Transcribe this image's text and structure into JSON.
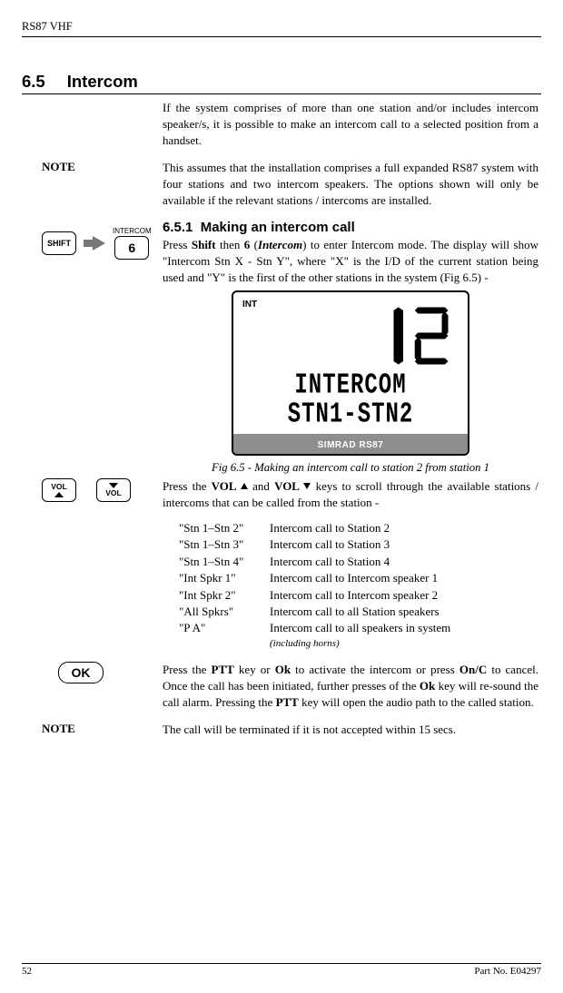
{
  "header": {
    "title": "RS87 VHF"
  },
  "section": {
    "number": "6.5",
    "title": "Intercom",
    "intro": "If the system comprises of more than one station and/or includes intercom speaker/s, it is possible to make an intercom call to a selected position from a handset."
  },
  "note1": {
    "label": "NOTE",
    "text": "This assumes that the installation comprises a full expanded RS87 system with four stations and two intercom speakers. The options shown will only be available if the relevant stations / intercoms are installed."
  },
  "icons": {
    "shift": "SHIFT",
    "intercom_label": "INTERCOM",
    "intercom_key": "6",
    "vol": "VOL",
    "ok": "OK"
  },
  "subsection": {
    "number": "6.5.1",
    "title": "Making an intercom call",
    "p1_a": "Press ",
    "p1_shift": "Shift",
    "p1_b": " then ",
    "p1_six": "6",
    "p1_c": " (",
    "p1_intercom": "Intercom",
    "p1_d": ") to enter Intercom mode.  The display will show \"Intercom Stn X - Stn Y\", where \"X\" is the I/D of the current station being used and \"Y\" is the first of the other stations in the system (Fig 6.5) -"
  },
  "figure": {
    "int": "INT",
    "line1": "INTERCOM",
    "line2": "STN1-STN2",
    "brand": "SIMRAD RS87",
    "caption": "Fig 6.5 - Making an intercom call to station 2 from station 1"
  },
  "p2_a": "Press the ",
  "p2_vol1": "VOL",
  "p2_b": " and ",
  "p2_vol2": "VOL",
  "p2_c": " keys to scroll through the available stations / intercoms that can be called from the station -",
  "options": [
    {
      "k": "\"Stn 1–Stn 2\"",
      "v": "Intercom call to Station 2"
    },
    {
      "k": "\"Stn 1–Stn 3\"",
      "v": "Intercom call to Station 3"
    },
    {
      "k": "\"Stn 1–Stn 4\"",
      "v": "Intercom call to Station 4"
    },
    {
      "k": "\"Int Spkr 1\"",
      "v": "Intercom call to Intercom speaker 1"
    },
    {
      "k": "\"Int Spkr 2\"",
      "v": "Intercom call to Intercom speaker 2"
    },
    {
      "k": "\"All Spkrs\"",
      "v": "Intercom call to all Station speakers"
    },
    {
      "k": "\"P A\"",
      "v": "Intercom call to all speakers in system"
    }
  ],
  "options_note": "(including horns)",
  "p3_a": "Press the ",
  "p3_ptt": "PTT",
  "p3_b": " key or ",
  "p3_ok": "Ok",
  "p3_c": " to activate the intercom or press ",
  "p3_onc": "On/C",
  "p3_d": " to cancel.  Once the call has been initiated, further presses of the ",
  "p3_ok2": "Ok",
  "p3_e": " key will re-sound the call alarm.  Pressing the ",
  "p3_ptt2": "PTT",
  "p3_f": " key will open the audio path to the called station.",
  "note2": {
    "label": "NOTE",
    "text": "The call will be terminated if it is not accepted within 15 secs."
  },
  "footer": {
    "page": "52",
    "part": "Part No. E04297"
  }
}
